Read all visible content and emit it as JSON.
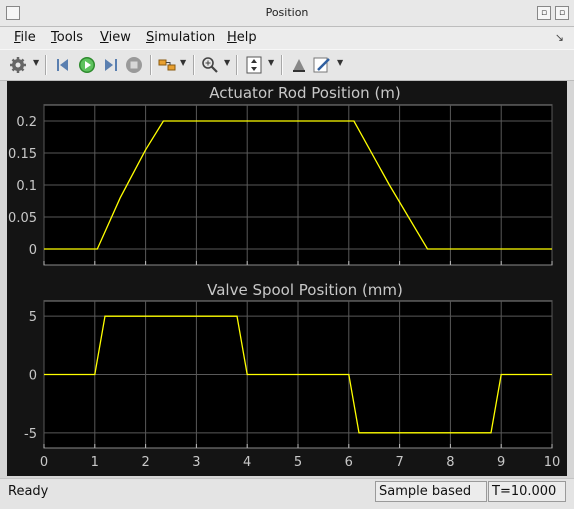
{
  "window": {
    "title": "Position"
  },
  "menu": {
    "items": [
      "File",
      "Tools",
      "View",
      "Simulation",
      "Help"
    ],
    "mnemonics": [
      "F",
      "T",
      "V",
      "S",
      "H"
    ]
  },
  "colors": {
    "trace": "#ffff00",
    "grid": "#595959",
    "axis_text": "#c8c8c8",
    "plot_bg": "#000000",
    "figure_bg": "#141414"
  },
  "toolbar": {
    "icons": [
      "gear-icon",
      "step-back-icon",
      "run-icon",
      "step-forward-icon",
      "stop-icon",
      "signal-select-icon",
      "zoom-icon",
      "autoscale-icon",
      "highlight-icon",
      "edit-icon"
    ]
  },
  "chart_data": [
    {
      "type": "line",
      "title": "Actuator Rod Position (m)",
      "xlim": [
        0,
        10
      ],
      "ylim": [
        -0.025,
        0.225
      ],
      "yticks": [
        "0",
        "0.05",
        "0.1",
        "0.15",
        "0.2"
      ],
      "ytick_values": [
        0,
        0.05,
        0.1,
        0.15,
        0.2
      ],
      "grid": true,
      "series": [
        {
          "x": [
            0,
            1.05,
            1.5,
            2.0,
            2.35,
            6.1,
            6.8,
            7.55,
            10
          ],
          "y": [
            0,
            0,
            0.08,
            0.155,
            0.2,
            0.2,
            0.1,
            0,
            0
          ]
        }
      ]
    },
    {
      "type": "line",
      "title": "Valve Spool Position (mm)",
      "xlim": [
        0,
        10
      ],
      "ylim": [
        -6.3,
        6.3
      ],
      "yticks": [
        "5",
        "0",
        "-5"
      ],
      "ytick_values": [
        5,
        0,
        -5
      ],
      "xticks": [
        "0",
        "1",
        "2",
        "3",
        "4",
        "5",
        "6",
        "7",
        "8",
        "9",
        "10"
      ],
      "grid": true,
      "series": [
        {
          "x": [
            0,
            1.0,
            1.2,
            3.8,
            4.0,
            6.0,
            6.2,
            8.8,
            9.0,
            10
          ],
          "y": [
            0,
            0,
            5,
            5,
            0,
            0,
            -5,
            -5,
            0,
            0
          ]
        }
      ]
    }
  ],
  "status": {
    "ready": "Ready",
    "sample_mode": "Sample based",
    "time": "T=10.000"
  }
}
